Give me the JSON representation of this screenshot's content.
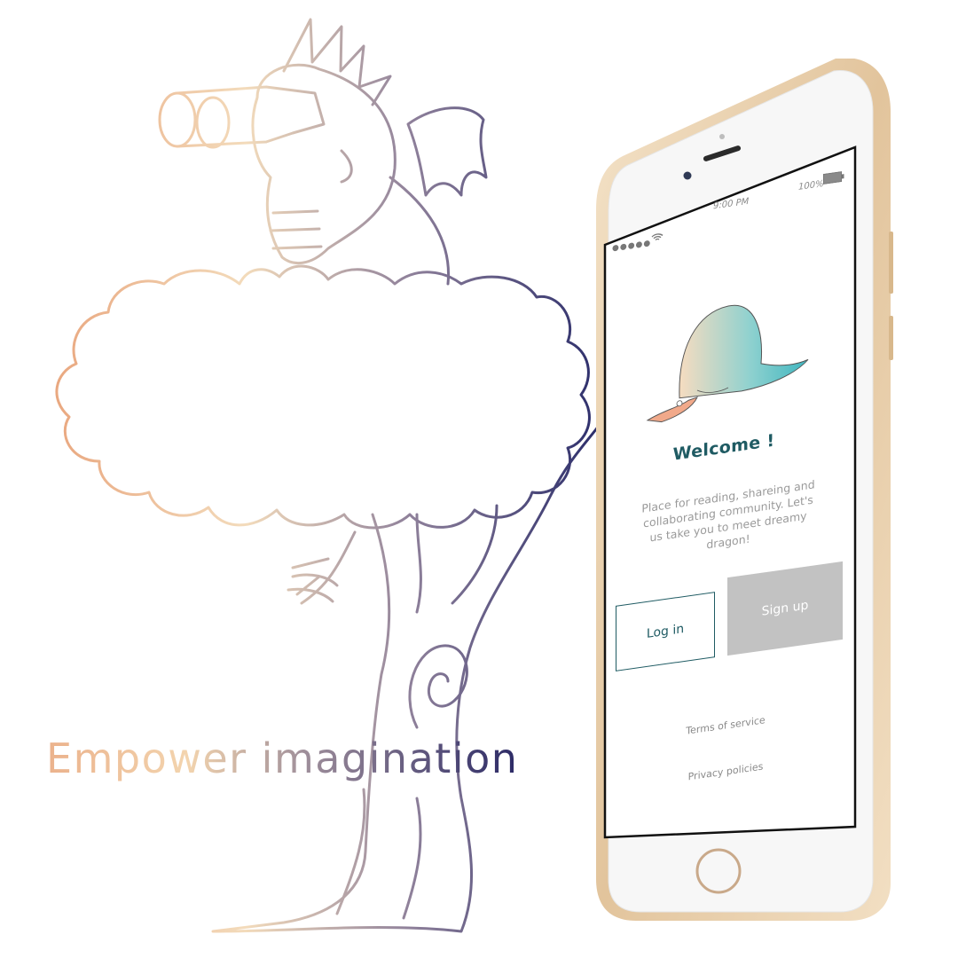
{
  "poster": {
    "tagline": "Empower imagination",
    "gradient_colors": [
      "#ebb28c",
      "#f3d4ae",
      "#9e8e9a",
      "#2c2a66"
    ]
  },
  "phone": {
    "frame_color": "#e9d3b4",
    "status_bar": {
      "signal": "●●●●●",
      "time": "9:00 PM",
      "battery": "100%"
    },
    "screen": {
      "title": "Welcome !",
      "description": "Place for reading, shareing and collaborating community. Let's us take you to meet dreamy dragon!",
      "login_label": "Log in",
      "signup_label": "Sign up",
      "terms_label": "Terms of service",
      "privacy_label": "Privacy policies",
      "accent_color": "#1f5b63",
      "signup_color": "#c2c2c2"
    }
  }
}
